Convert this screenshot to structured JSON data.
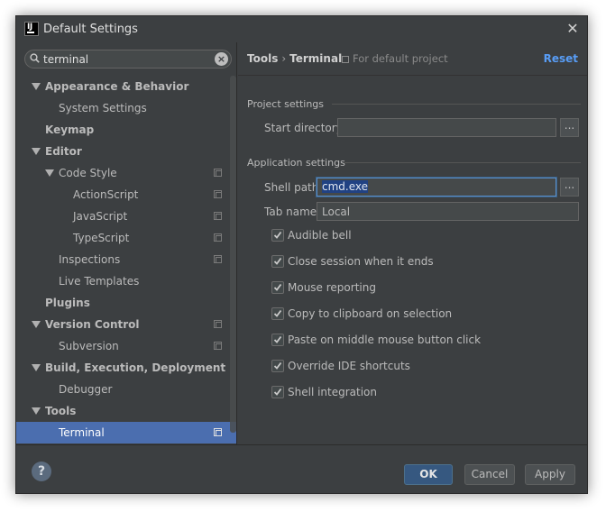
{
  "window": {
    "title": "Default Settings"
  },
  "search": {
    "value": "terminal"
  },
  "tree": [
    {
      "label": "Appearance & Behavior",
      "bold": true,
      "arrow": true,
      "level": 0
    },
    {
      "label": "System Settings",
      "bold": false,
      "arrow": false,
      "level": 1
    },
    {
      "label": "Keymap",
      "bold": true,
      "arrow": false,
      "level": 0
    },
    {
      "label": "Editor",
      "bold": true,
      "arrow": true,
      "level": 0
    },
    {
      "label": "Code Style",
      "bold": false,
      "arrow": true,
      "level": 1,
      "project": true
    },
    {
      "label": "ActionScript",
      "bold": false,
      "arrow": false,
      "level": 2,
      "project": true
    },
    {
      "label": "JavaScript",
      "bold": false,
      "arrow": false,
      "level": 2,
      "project": true
    },
    {
      "label": "TypeScript",
      "bold": false,
      "arrow": false,
      "level": 2,
      "project": true
    },
    {
      "label": "Inspections",
      "bold": false,
      "arrow": false,
      "level": 1,
      "project": true
    },
    {
      "label": "Live Templates",
      "bold": false,
      "arrow": false,
      "level": 1
    },
    {
      "label": "Plugins",
      "bold": true,
      "arrow": false,
      "level": 0
    },
    {
      "label": "Version Control",
      "bold": true,
      "arrow": true,
      "level": 0,
      "project": true
    },
    {
      "label": "Subversion",
      "bold": false,
      "arrow": false,
      "level": 1,
      "project": true
    },
    {
      "label": "Build, Execution, Deployment",
      "bold": true,
      "arrow": true,
      "level": 0
    },
    {
      "label": "Debugger",
      "bold": false,
      "arrow": false,
      "level": 1
    },
    {
      "label": "Tools",
      "bold": true,
      "arrow": true,
      "level": 0
    },
    {
      "label": "Terminal",
      "bold": false,
      "arrow": false,
      "level": 1,
      "project": true,
      "selected": true
    }
  ],
  "header": {
    "crumb_parent": "Tools",
    "crumb_sep": "›",
    "crumb_current": "Terminal",
    "scope": "For default project",
    "reset": "Reset"
  },
  "project_settings": {
    "title": "Project settings",
    "start_directory_label": "Start directory",
    "start_directory_value": "",
    "browse": "..."
  },
  "application_settings": {
    "title": "Application settings",
    "shell_path_label": "Shell path",
    "shell_path_value": "cmd.exe",
    "tab_name_label": "Tab name",
    "tab_name_value": "Local",
    "browse": "..."
  },
  "checkboxes": [
    {
      "label": "Audible bell",
      "checked": true
    },
    {
      "label": "Close session when it ends",
      "checked": true
    },
    {
      "label": "Mouse reporting",
      "checked": true
    },
    {
      "label": "Copy to clipboard on selection",
      "checked": true
    },
    {
      "label": "Paste on middle mouse button click",
      "checked": true
    },
    {
      "label": "Override IDE shortcuts",
      "checked": true
    },
    {
      "label": "Shell integration",
      "checked": true
    }
  ],
  "footer": {
    "help": "?",
    "ok": "OK",
    "cancel": "Cancel",
    "apply": "Apply"
  },
  "colors": {
    "background": "#3c3f41",
    "selection": "#4b6eaf",
    "link": "#589df6",
    "default_button": "#365880"
  }
}
